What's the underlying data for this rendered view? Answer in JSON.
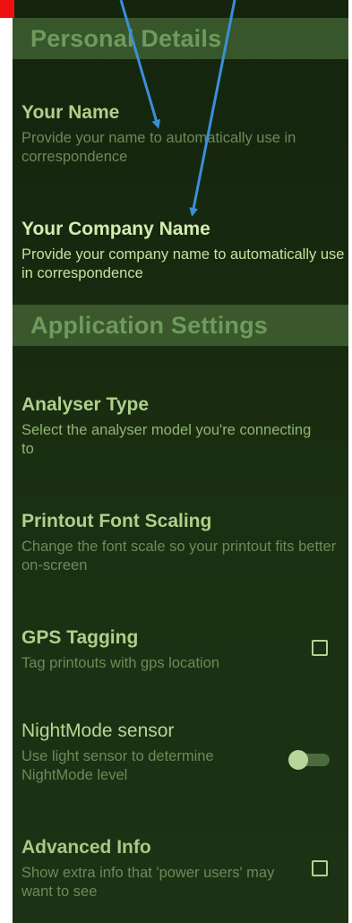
{
  "sections": {
    "personal": "Personal Details",
    "application": "Application Settings"
  },
  "prefs": {
    "your_name": {
      "title": "Your Name",
      "summary": "Provide your name to automatically use in correspondence"
    },
    "company_name": {
      "title": "Your Company Name",
      "summary": "Provide your company name to automatically use in correspondence"
    },
    "analyser_type": {
      "title": "Analyser Type",
      "summary": "Select the analyser model you're connecting to"
    },
    "font_scaling": {
      "title": "Printout Font Scaling",
      "summary": "Change the font scale so your printout fits better on-screen"
    },
    "gps_tagging": {
      "title": "GPS Tagging",
      "summary": "Tag printouts with gps location",
      "checked": false
    },
    "nightmode_sensor": {
      "title": "NightMode sensor",
      "summary": "Use light sensor to determine NightMode level",
      "enabled": false
    },
    "advanced_info": {
      "title": "Advanced Info",
      "summary": "Show extra info that 'power users' may want to see",
      "checked": false
    }
  },
  "colors": {
    "background": "#17290f",
    "accent": "#b0cf8c",
    "annotation_arrow": "#3b8fd6",
    "annotation_mark": "#ee1111"
  }
}
